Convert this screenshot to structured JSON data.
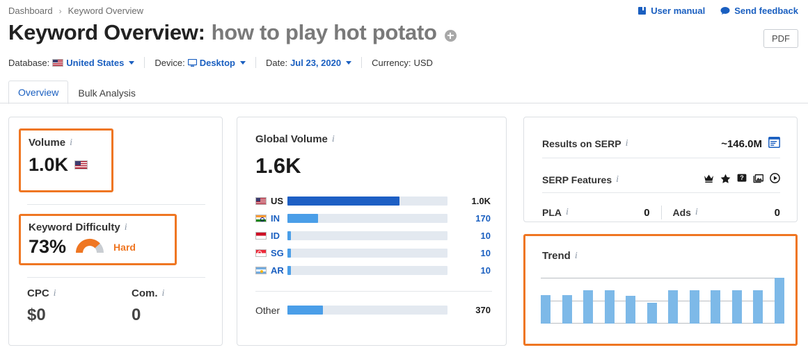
{
  "breadcrumb": {
    "root": "Dashboard",
    "separator": "›",
    "current": "Keyword Overview"
  },
  "toplinks": {
    "manual": "User manual",
    "feedback": "Send feedback"
  },
  "header": {
    "title_prefix": "Keyword Overview:",
    "keyword": "how to play hot potato",
    "add_keyword_icon": "plus-circle-icon",
    "pdf_label": "PDF"
  },
  "filters": {
    "database_label": "Database:",
    "database_value": "United States",
    "database_flag": "us-flag-icon",
    "device_label": "Device:",
    "device_value": "Desktop",
    "device_icon": "monitor-icon",
    "date_label": "Date:",
    "date_value": "Jul 23, 2020",
    "currency_label": "Currency:",
    "currency_value": "USD"
  },
  "tabs": [
    {
      "label": "Overview",
      "active": true
    },
    {
      "label": "Bulk Analysis",
      "active": false
    }
  ],
  "metrics": {
    "volume": {
      "label": "Volume",
      "value": "1.0K",
      "flag": "us-flag-icon",
      "highlighted": true
    },
    "keyword_difficulty": {
      "label": "Keyword Difficulty",
      "value": "73%",
      "rating": "Hard",
      "percent": 73,
      "highlighted": true
    },
    "cpc": {
      "label": "CPC",
      "value": "$0"
    },
    "competition": {
      "label": "Com.",
      "value": "0"
    }
  },
  "global_volume": {
    "label": "Global Volume",
    "total": "1.6K",
    "other_label": "Other",
    "other_value": "370",
    "other_percent": 22
  },
  "serp": {
    "results_label": "Results on SERP",
    "results_value": "~146.0M",
    "results_icon": "serp-report-icon",
    "features_label": "SERP Features",
    "features_icons": [
      "crown-icon",
      "star-icon",
      "question-box-icon",
      "image-icon",
      "play-circle-icon"
    ],
    "pla_label": "PLA",
    "pla_value": "0",
    "ads_label": "Ads",
    "ads_value": "0"
  },
  "trend": {
    "label": "Trend"
  },
  "colors": {
    "accent_orange": "#ef7622",
    "link_blue": "#1a5fc0",
    "bar_dark_blue": "#1d5fc4",
    "bar_light_blue": "#4a9ee8",
    "bar_track": "#e3e9f0",
    "trend_bar": "#7db9e8"
  },
  "chart_data": [
    {
      "type": "bar",
      "title": "Global Volume",
      "orientation": "horizontal",
      "categories": [
        "US",
        "IN",
        "ID",
        "SG",
        "AR",
        "Other"
      ],
      "values": [
        1000,
        170,
        10,
        10,
        10,
        370
      ],
      "value_labels": [
        "1.0K",
        "170",
        "10",
        "10",
        "10",
        "370"
      ],
      "bar_percent": [
        70,
        19,
        2,
        2,
        2,
        22
      ],
      "flags": [
        "us-flag-icon",
        "in-flag-icon",
        "id-flag-icon",
        "sg-flag-icon",
        "ar-flag-icon",
        null
      ],
      "series_colors": [
        "#1d5fc4",
        "#4a9ee8",
        "#4a9ee8",
        "#4a9ee8",
        "#4a9ee8",
        "#4a9ee8"
      ],
      "total": "1.6K",
      "xlabel": "",
      "ylabel": "",
      "grid": false,
      "legend": false
    },
    {
      "type": "bar",
      "title": "Trend",
      "x": [
        1,
        2,
        3,
        4,
        5,
        6,
        7,
        8,
        9,
        10,
        11,
        12
      ],
      "values": [
        0.62,
        0.62,
        0.72,
        0.72,
        0.6,
        0.46,
        0.72,
        0.72,
        0.72,
        0.72,
        0.72,
        1.0
      ],
      "ylim": [
        0,
        1
      ],
      "grid": true,
      "gridlines": 3,
      "xlabel": "",
      "ylabel": "",
      "legend": false,
      "tick_labels": []
    }
  ]
}
